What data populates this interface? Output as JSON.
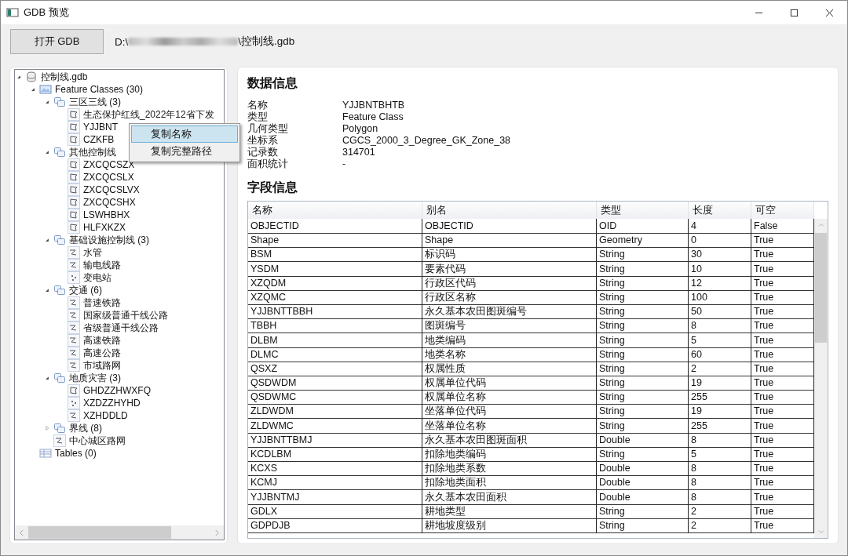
{
  "window": {
    "title": "GDB 预览"
  },
  "open_button": "打开 GDB",
  "path": {
    "prefix": "D:\\",
    "suffix": "\\控制线.gdb"
  },
  "tree": [
    {
      "label": "控制线.gdb",
      "kind": "gdb",
      "expanded": true,
      "children": [
        {
          "label": "Feature Classes (30)",
          "kind": "featureclasses",
          "expanded": true,
          "children": [
            {
              "label": "三区三线 (3)",
              "kind": "dataset",
              "expanded": true,
              "children": [
                {
                  "label": "生态保护红线_2022年12省下发",
                  "kind": "polygon"
                },
                {
                  "label": "YJJBNT",
                  "kind": "polygon"
                },
                {
                  "label": "CZKFB",
                  "kind": "polygon"
                }
              ]
            },
            {
              "label": "其他控制线",
              "kind": "dataset",
              "expanded": true,
              "children": [
                {
                  "label": "ZXCQCSZX",
                  "kind": "polygon"
                },
                {
                  "label": "ZXCQCSLX",
                  "kind": "polygon"
                },
                {
                  "label": "ZXCQCSLVX",
                  "kind": "polygon"
                },
                {
                  "label": "ZXCQCSHX",
                  "kind": "polygon"
                },
                {
                  "label": "LSWHBHX",
                  "kind": "polygon"
                },
                {
                  "label": "HLFXKZX",
                  "kind": "polygon"
                }
              ]
            },
            {
              "label": "基础设施控制线 (3)",
              "kind": "dataset",
              "expanded": true,
              "children": [
                {
                  "label": "水管",
                  "kind": "line"
                },
                {
                  "label": "输电线路",
                  "kind": "line"
                },
                {
                  "label": "变电站",
                  "kind": "point"
                }
              ]
            },
            {
              "label": "交通 (6)",
              "kind": "dataset",
              "expanded": true,
              "children": [
                {
                  "label": "普速铁路",
                  "kind": "line"
                },
                {
                  "label": "国家级普通干线公路",
                  "kind": "line"
                },
                {
                  "label": "省级普通干线公路",
                  "kind": "line"
                },
                {
                  "label": "高速铁路",
                  "kind": "line"
                },
                {
                  "label": "高速公路",
                  "kind": "line"
                },
                {
                  "label": "市域路网",
                  "kind": "line"
                }
              ]
            },
            {
              "label": "地质灾害 (3)",
              "kind": "dataset",
              "expanded": true,
              "children": [
                {
                  "label": "GHDZZHWXFQ",
                  "kind": "polygon"
                },
                {
                  "label": "XZDZZHYHD",
                  "kind": "point"
                },
                {
                  "label": "XZHDDLD",
                  "kind": "line"
                }
              ]
            },
            {
              "label": "界线 (8)",
              "kind": "dataset",
              "expanded": false
            },
            {
              "label": "中心城区路网",
              "kind": "line"
            }
          ]
        },
        {
          "label": "Tables (0)",
          "kind": "tables"
        }
      ]
    }
  ],
  "context_menu": [
    {
      "label": "复制名称",
      "selected": true
    },
    {
      "label": "复制完整路径",
      "selected": false
    }
  ],
  "info": {
    "title": "数据信息",
    "rows": [
      {
        "label": "名称",
        "value": "YJJBNTBHTB"
      },
      {
        "label": "类型",
        "value": "Feature Class"
      },
      {
        "label": "几何类型",
        "value": "Polygon"
      },
      {
        "label": "坐标系",
        "value": "CGCS_2000_3_Degree_GK_Zone_38"
      },
      {
        "label": "记录数",
        "value": "314701"
      },
      {
        "label": "面积统计",
        "value": "-"
      }
    ]
  },
  "fields": {
    "title": "字段信息",
    "columns": [
      "名称",
      "别名",
      "类型",
      "长度",
      "可空"
    ],
    "rows": [
      [
        "OBJECTID",
        "OBJECTID",
        "OID",
        "4",
        "False"
      ],
      [
        "Shape",
        "Shape",
        "Geometry",
        "0",
        "True"
      ],
      [
        "BSM",
        "标识码",
        "String",
        "30",
        "True"
      ],
      [
        "YSDM",
        "要素代码",
        "String",
        "10",
        "True"
      ],
      [
        "XZQDM",
        "行政区代码",
        "String",
        "12",
        "True"
      ],
      [
        "XZQMC",
        "行政区名称",
        "String",
        "100",
        "True"
      ],
      [
        "YJJBNTTBBH",
        "永久基本农田图斑编号",
        "String",
        "50",
        "True"
      ],
      [
        "TBBH",
        "图斑编号",
        "String",
        "8",
        "True"
      ],
      [
        "DLBM",
        "地类编码",
        "String",
        "5",
        "True"
      ],
      [
        "DLMC",
        "地类名称",
        "String",
        "60",
        "True"
      ],
      [
        "QSXZ",
        "权属性质",
        "String",
        "2",
        "True"
      ],
      [
        "QSDWDM",
        "权属单位代码",
        "String",
        "19",
        "True"
      ],
      [
        "QSDWMC",
        "权属单位名称",
        "String",
        "255",
        "True"
      ],
      [
        "ZLDWDM",
        "坐落单位代码",
        "String",
        "19",
        "True"
      ],
      [
        "ZLDWMC",
        "坐落单位名称",
        "String",
        "255",
        "True"
      ],
      [
        "YJJBNTTBMJ",
        "永久基本农田图斑面积",
        "Double",
        "8",
        "True"
      ],
      [
        "KCDLBM",
        "扣除地类编码",
        "String",
        "5",
        "True"
      ],
      [
        "KCXS",
        "扣除地类系数",
        "Double",
        "8",
        "True"
      ],
      [
        "KCMJ",
        "扣除地类面积",
        "Double",
        "8",
        "True"
      ],
      [
        "YJJBNTMJ",
        "永久基本农田面积",
        "Double",
        "8",
        "True"
      ],
      [
        "GDLX",
        "耕地类型",
        "String",
        "2",
        "True"
      ],
      [
        "GDPDJB",
        "耕地坡度级别",
        "String",
        "2",
        "True"
      ]
    ]
  }
}
